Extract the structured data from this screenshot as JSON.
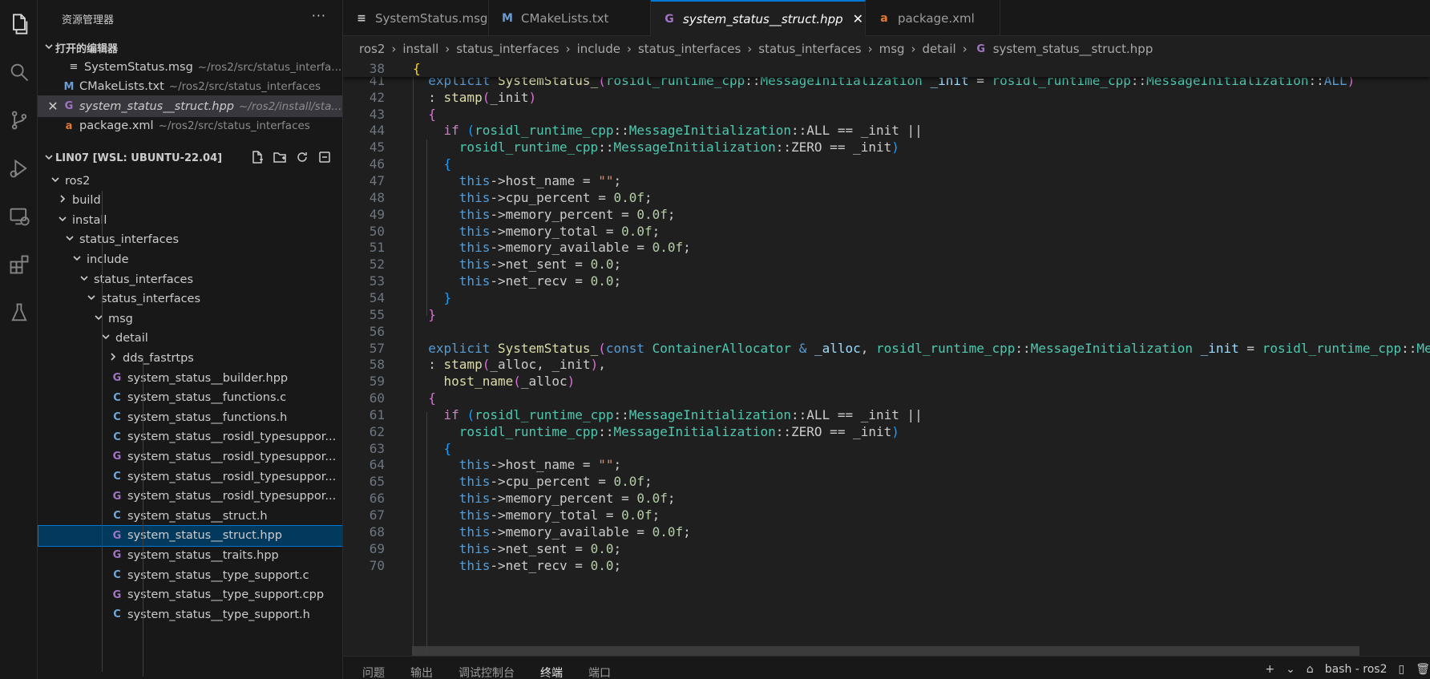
{
  "sidebar": {
    "title": "资源管理器",
    "more": "···",
    "open_editors_label": "打开的编辑器",
    "open_editors": [
      {
        "icon": "≡",
        "kind": "msg",
        "name": "SystemStatus.msg",
        "path": "~/ros2/src/status_interfa..."
      },
      {
        "icon": "M",
        "kind": "m",
        "name": "CMakeLists.txt",
        "path": "~/ros2/src/status_interfaces"
      },
      {
        "icon": "G",
        "kind": "cpp",
        "name": "system_status__struct.hpp",
        "path": "~/ros2/install/sta..."
      },
      {
        "icon": "a",
        "kind": "xml",
        "name": "package.xml",
        "path": "~/ros2/src/status_interfaces"
      }
    ],
    "workspace_label": "LIN07 [WSL: UBUNTU-22.04]",
    "tree": [
      {
        "label": "ros2",
        "depth": 0,
        "chev": "down"
      },
      {
        "label": "build",
        "depth": 1,
        "chev": "right"
      },
      {
        "label": "install",
        "depth": 1,
        "chev": "down"
      },
      {
        "label": "status_interfaces",
        "depth": 2,
        "chev": "down"
      },
      {
        "label": "include",
        "depth": 3,
        "chev": "down"
      },
      {
        "label": "status_interfaces",
        "depth": 4,
        "chev": "down"
      },
      {
        "label": "status_interfaces",
        "depth": 5,
        "chev": "down"
      },
      {
        "label": "msg",
        "depth": 6,
        "chev": "down"
      },
      {
        "label": "detail",
        "depth": 7,
        "chev": "down"
      },
      {
        "label": "dds_fastrtps",
        "depth": 8,
        "chev": "right"
      },
      {
        "label": "system_status__builder.hpp",
        "depth": 8,
        "icon": "G",
        "kind": "cpp"
      },
      {
        "label": "system_status__functions.c",
        "depth": 8,
        "icon": "C",
        "kind": "c"
      },
      {
        "label": "system_status__functions.h",
        "depth": 8,
        "icon": "C",
        "kind": "c"
      },
      {
        "label": "system_status__rosidl_typesuppor...",
        "depth": 8,
        "icon": "C",
        "kind": "c"
      },
      {
        "label": "system_status__rosidl_typesuppor...",
        "depth": 8,
        "icon": "G",
        "kind": "cpp"
      },
      {
        "label": "system_status__rosidl_typesuppor...",
        "depth": 8,
        "icon": "C",
        "kind": "c"
      },
      {
        "label": "system_status__rosidl_typesuppor...",
        "depth": 8,
        "icon": "G",
        "kind": "cpp"
      },
      {
        "label": "system_status__struct.h",
        "depth": 8,
        "icon": "C",
        "kind": "c"
      },
      {
        "label": "system_status__struct.hpp",
        "depth": 8,
        "icon": "G",
        "kind": "cpp",
        "selected": true
      },
      {
        "label": "system_status__traits.hpp",
        "depth": 8,
        "icon": "G",
        "kind": "cpp"
      },
      {
        "label": "system_status__type_support.c",
        "depth": 8,
        "icon": "C",
        "kind": "c"
      },
      {
        "label": "system_status__type_support.cpp",
        "depth": 8,
        "icon": "G",
        "kind": "cpp"
      },
      {
        "label": "system_status__type_support.h",
        "depth": 8,
        "icon": "C",
        "kind": "c"
      }
    ]
  },
  "tabs": [
    {
      "icon": "≡",
      "kind": "msg",
      "label": "SystemStatus.msg"
    },
    {
      "icon": "M",
      "kind": "m",
      "label": "CMakeLists.txt"
    },
    {
      "icon": "G",
      "kind": "cpp",
      "label": "system_status__struct.hpp",
      "active": true
    },
    {
      "icon": "a",
      "kind": "xml",
      "label": "package.xml"
    }
  ],
  "breadcrumb": [
    "ros2",
    "install",
    "status_interfaces",
    "include",
    "status_interfaces",
    "status_interfaces",
    "msg",
    "detail",
    "system_status__struct.hpp"
  ],
  "editor": {
    "lines": [
      {
        "n": "38",
        "sticky": true,
        "t": [
          [
            "b1",
            "{"
          ]
        ]
      },
      {
        "n": "41",
        "t": [
          [
            "",
            "  "
          ],
          [
            "kw",
            "explicit"
          ],
          [
            "",
            " "
          ],
          [
            "fn",
            "SystemStatus_"
          ],
          [
            "b2",
            "("
          ],
          [
            "ty",
            "rosidl_runtime_cpp"
          ],
          [
            "",
            "::"
          ],
          [
            "ty",
            "MessageInitialization"
          ],
          [
            "",
            " "
          ],
          [
            "var",
            "_init"
          ],
          [
            "",
            " = "
          ],
          [
            "ty",
            "rosidl_runtime_cpp"
          ],
          [
            "",
            "::"
          ],
          [
            "ty",
            "MessageInitialization"
          ],
          [
            "",
            "::"
          ],
          [
            "kw",
            "ALL"
          ],
          [
            "b2",
            ")"
          ]
        ]
      },
      {
        "n": "42",
        "t": [
          [
            "",
            "  : "
          ],
          [
            "fn",
            "stamp"
          ],
          [
            "b2",
            "("
          ],
          [
            "",
            "_init"
          ],
          [
            "b2",
            ")"
          ]
        ]
      },
      {
        "n": "43",
        "t": [
          [
            "",
            "  "
          ],
          [
            "b2",
            "{"
          ]
        ]
      },
      {
        "n": "44",
        "t": [
          [
            "",
            "    "
          ],
          [
            "ctl",
            "if"
          ],
          [
            "",
            " "
          ],
          [
            "b3",
            "("
          ],
          [
            "ty",
            "rosidl_runtime_cpp"
          ],
          [
            "",
            "::"
          ],
          [
            "ty",
            "MessageInitialization"
          ],
          [
            "",
            "::ALL == _init ||"
          ]
        ]
      },
      {
        "n": "45",
        "t": [
          [
            "",
            "      "
          ],
          [
            "ty",
            "rosidl_runtime_cpp"
          ],
          [
            "",
            "::"
          ],
          [
            "ty",
            "MessageInitialization"
          ],
          [
            "",
            "::ZERO == _init"
          ],
          [
            "b3",
            ")"
          ]
        ]
      },
      {
        "n": "46",
        "t": [
          [
            "",
            "    "
          ],
          [
            "b3",
            "{"
          ]
        ]
      },
      {
        "n": "47",
        "t": [
          [
            "",
            "      "
          ],
          [
            "kw",
            "this"
          ],
          [
            "",
            "->host_name = "
          ],
          [
            "str",
            "\"\""
          ],
          [
            "",
            ";"
          ]
        ]
      },
      {
        "n": "48",
        "t": [
          [
            "",
            "      "
          ],
          [
            "kw",
            "this"
          ],
          [
            "",
            "->cpu_percent = "
          ],
          [
            "num",
            "0.0f"
          ],
          [
            "",
            ";"
          ]
        ]
      },
      {
        "n": "49",
        "t": [
          [
            "",
            "      "
          ],
          [
            "kw",
            "this"
          ],
          [
            "",
            "->memory_percent = "
          ],
          [
            "num",
            "0.0f"
          ],
          [
            "",
            ";"
          ]
        ]
      },
      {
        "n": "50",
        "t": [
          [
            "",
            "      "
          ],
          [
            "kw",
            "this"
          ],
          [
            "",
            "->memory_total = "
          ],
          [
            "num",
            "0.0f"
          ],
          [
            "",
            ";"
          ]
        ]
      },
      {
        "n": "51",
        "t": [
          [
            "",
            "      "
          ],
          [
            "kw",
            "this"
          ],
          [
            "",
            "->memory_available = "
          ],
          [
            "num",
            "0.0f"
          ],
          [
            "",
            ";"
          ]
        ]
      },
      {
        "n": "52",
        "t": [
          [
            "",
            "      "
          ],
          [
            "kw",
            "this"
          ],
          [
            "",
            "->net_sent = "
          ],
          [
            "num",
            "0.0"
          ],
          [
            "",
            ";"
          ]
        ]
      },
      {
        "n": "53",
        "t": [
          [
            "",
            "      "
          ],
          [
            "kw",
            "this"
          ],
          [
            "",
            "->net_recv = "
          ],
          [
            "num",
            "0.0"
          ],
          [
            "",
            ";"
          ]
        ]
      },
      {
        "n": "54",
        "t": [
          [
            "",
            "    "
          ],
          [
            "b3",
            "}"
          ]
        ]
      },
      {
        "n": "55",
        "t": [
          [
            "",
            "  "
          ],
          [
            "b2",
            "}"
          ]
        ]
      },
      {
        "n": "56",
        "t": [
          [
            "",
            ""
          ]
        ]
      },
      {
        "n": "57",
        "t": [
          [
            "",
            "  "
          ],
          [
            "kw",
            "explicit"
          ],
          [
            "",
            " "
          ],
          [
            "fn",
            "SystemStatus_"
          ],
          [
            "b2",
            "("
          ],
          [
            "kw",
            "const"
          ],
          [
            "",
            " "
          ],
          [
            "ty",
            "ContainerAllocator"
          ],
          [
            "",
            " "
          ],
          [
            "kw",
            "&"
          ],
          [
            "",
            " "
          ],
          [
            "var",
            "_alloc"
          ],
          [
            "",
            ", "
          ],
          [
            "ty",
            "rosidl_runtime_cpp"
          ],
          [
            "",
            "::"
          ],
          [
            "ty",
            "MessageInitialization"
          ],
          [
            "",
            " "
          ],
          [
            "var",
            "_init"
          ],
          [
            "",
            " = "
          ],
          [
            "ty",
            "rosidl_runtime_cpp"
          ],
          [
            "",
            "::"
          ],
          [
            "ty",
            "Me"
          ]
        ]
      },
      {
        "n": "58",
        "t": [
          [
            "",
            "  : "
          ],
          [
            "fn",
            "stamp"
          ],
          [
            "b2",
            "("
          ],
          [
            "",
            "_alloc, _init"
          ],
          [
            "b2",
            ")"
          ],
          [
            "",
            ","
          ]
        ]
      },
      {
        "n": "59",
        "t": [
          [
            "",
            "    "
          ],
          [
            "fn",
            "host_name"
          ],
          [
            "b2",
            "("
          ],
          [
            "",
            "_alloc"
          ],
          [
            "b2",
            ")"
          ]
        ]
      },
      {
        "n": "60",
        "t": [
          [
            "",
            "  "
          ],
          [
            "b2",
            "{"
          ]
        ]
      },
      {
        "n": "61",
        "t": [
          [
            "",
            "    "
          ],
          [
            "ctl",
            "if"
          ],
          [
            "",
            " "
          ],
          [
            "b3",
            "("
          ],
          [
            "ty",
            "rosidl_runtime_cpp"
          ],
          [
            "",
            "::"
          ],
          [
            "ty",
            "MessageInitialization"
          ],
          [
            "",
            "::ALL == _init ||"
          ]
        ]
      },
      {
        "n": "62",
        "t": [
          [
            "",
            "      "
          ],
          [
            "ty",
            "rosidl_runtime_cpp"
          ],
          [
            "",
            "::"
          ],
          [
            "ty",
            "MessageInitialization"
          ],
          [
            "",
            "::ZERO == _init"
          ],
          [
            "b3",
            ")"
          ]
        ]
      },
      {
        "n": "63",
        "t": [
          [
            "",
            "    "
          ],
          [
            "b3",
            "{"
          ]
        ]
      },
      {
        "n": "64",
        "t": [
          [
            "",
            "      "
          ],
          [
            "kw",
            "this"
          ],
          [
            "",
            "->host_name = "
          ],
          [
            "str",
            "\"\""
          ],
          [
            "",
            ";"
          ]
        ]
      },
      {
        "n": "65",
        "t": [
          [
            "",
            "      "
          ],
          [
            "kw",
            "this"
          ],
          [
            "",
            "->cpu_percent = "
          ],
          [
            "num",
            "0.0f"
          ],
          [
            "",
            ";"
          ]
        ]
      },
      {
        "n": "66",
        "t": [
          [
            "",
            "      "
          ],
          [
            "kw",
            "this"
          ],
          [
            "",
            "->memory_percent = "
          ],
          [
            "num",
            "0.0f"
          ],
          [
            "",
            ";"
          ]
        ]
      },
      {
        "n": "67",
        "t": [
          [
            "",
            "      "
          ],
          [
            "kw",
            "this"
          ],
          [
            "",
            "->memory_total = "
          ],
          [
            "num",
            "0.0f"
          ],
          [
            "",
            ";"
          ]
        ]
      },
      {
        "n": "68",
        "t": [
          [
            "",
            "      "
          ],
          [
            "kw",
            "this"
          ],
          [
            "",
            "->memory_available = "
          ],
          [
            "num",
            "0.0f"
          ],
          [
            "",
            ";"
          ]
        ]
      },
      {
        "n": "69",
        "t": [
          [
            "",
            "      "
          ],
          [
            "kw",
            "this"
          ],
          [
            "",
            "->net_sent = "
          ],
          [
            "num",
            "0.0"
          ],
          [
            "",
            ";"
          ]
        ]
      },
      {
        "n": "70",
        "t": [
          [
            "",
            "      "
          ],
          [
            "kw",
            "this"
          ],
          [
            "",
            "->net_recv = "
          ],
          [
            "num",
            "0.0"
          ],
          [
            "",
            ";"
          ]
        ]
      }
    ]
  },
  "panel": {
    "tabs": [
      "问题",
      "输出",
      "调试控制台",
      "终端",
      "端口"
    ],
    "active": "终端",
    "add": "+",
    "dropdown": "⌄",
    "terminal_name": "bash - ros2"
  }
}
